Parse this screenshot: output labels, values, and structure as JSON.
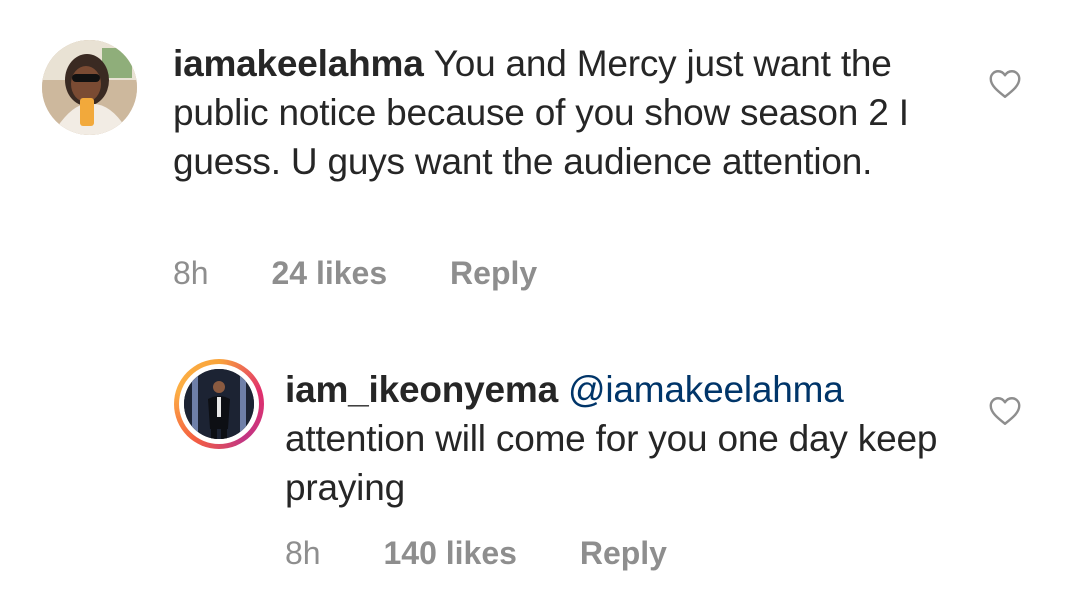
{
  "comments": [
    {
      "username": "iamakeelahma",
      "text": "You and Mercy just want the public notice because of you show season 2 I guess. U guys want the audience attention.",
      "time": "8h",
      "likes": "24 likes",
      "reply_label": "Reply",
      "icons": {
        "avatar": "user-avatar",
        "like": "heart-outline-icon"
      }
    },
    {
      "username": "iam_ikeonyema",
      "mention": "@iamakeelahma",
      "text": "attention will come for you one day keep praying",
      "time": "8h",
      "likes": "140 likes",
      "reply_label": "Reply",
      "icons": {
        "avatar": "story-ring-avatar",
        "like": "heart-outline-icon"
      }
    }
  ],
  "colors": {
    "text": "#262626",
    "meta": "#8e8e8e",
    "mention": "#003569",
    "heart_stroke": "#8e8e8e"
  }
}
